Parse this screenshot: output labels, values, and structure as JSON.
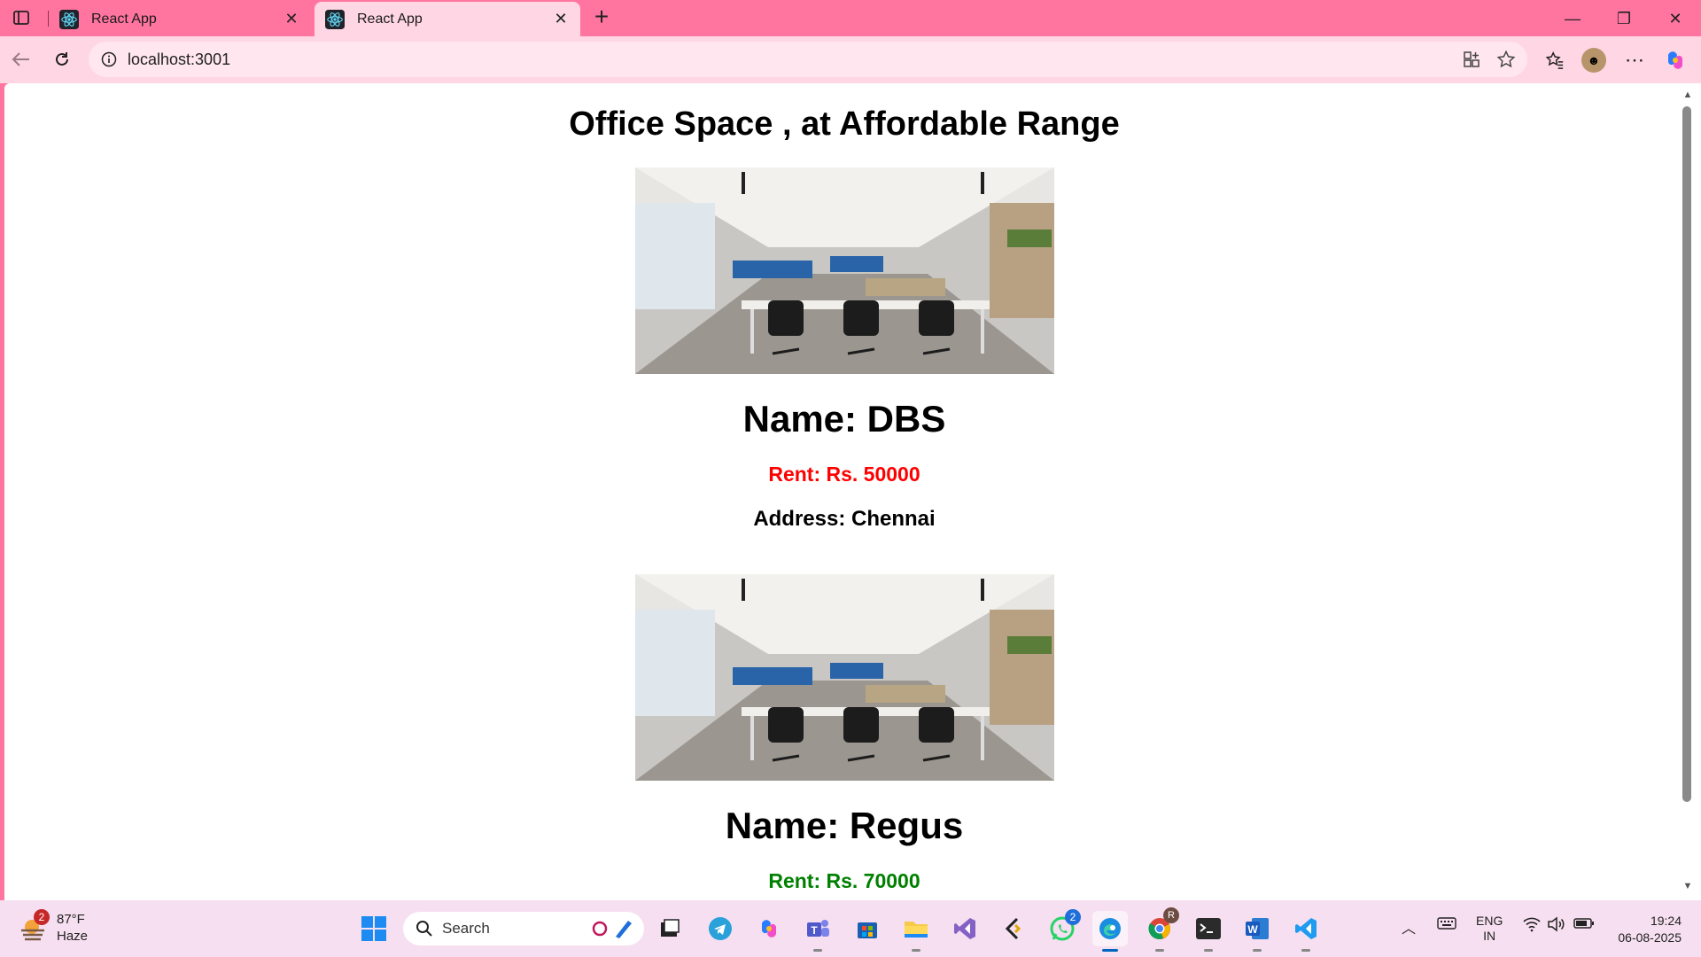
{
  "browser": {
    "tabs": [
      {
        "title": "React App",
        "active": false
      },
      {
        "title": "React App",
        "active": true
      }
    ],
    "url": "localhost:3001",
    "accent": "#ff75a0"
  },
  "page": {
    "heading": "Office Space , at Affordable Range",
    "offices": [
      {
        "name": "Name: DBS",
        "rent": "Rent: Rs. 50000",
        "rent_color": "#ff0000",
        "address": "Address: Chennai"
      },
      {
        "name": "Name: Regus",
        "rent": "Rent: Rs. 70000",
        "rent_color": "#008000",
        "address": ""
      }
    ]
  },
  "taskbar": {
    "weather": {
      "badge": "2",
      "temp": "87°F",
      "condition": "Haze"
    },
    "search_placeholder": "Search",
    "whatsapp_badge": "2",
    "chrome_badge": "R",
    "language": {
      "lang": "ENG",
      "region": "IN"
    },
    "time": "19:24",
    "date": "06-08-2025"
  }
}
